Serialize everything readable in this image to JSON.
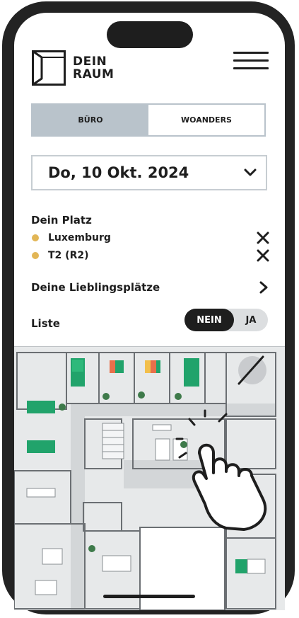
{
  "brand": {
    "line1": "DEIN",
    "line2": "RAUM"
  },
  "tabs": [
    {
      "label": "BÜRO",
      "active": true
    },
    {
      "label": "WOANDERS",
      "active": false
    }
  ],
  "date": {
    "value": "Do, 10 Okt. 2024"
  },
  "my_place": {
    "title": "Dein Platz",
    "items": [
      {
        "name": "Luxemburg"
      },
      {
        "name": "T2 (R2)"
      }
    ]
  },
  "favorites": {
    "label": "Deine Lieblingsplätze"
  },
  "list": {
    "label": "Liste",
    "options": [
      "NEIN",
      "JA"
    ],
    "selected": "NEIN"
  },
  "colors": {
    "accent_gray": "#b9c3cb",
    "dot": "#e2b656",
    "desk_green": "#21a36b",
    "desk_orange": "#e8704b",
    "desk_yellow": "#f2bf4b",
    "frame": "#232323"
  },
  "icons": [
    "hamburger-menu-icon",
    "chevron-down-icon",
    "close-icon",
    "chevron-right-icon",
    "no-location-icon",
    "tap-hand-icon",
    "plant-icon"
  ]
}
